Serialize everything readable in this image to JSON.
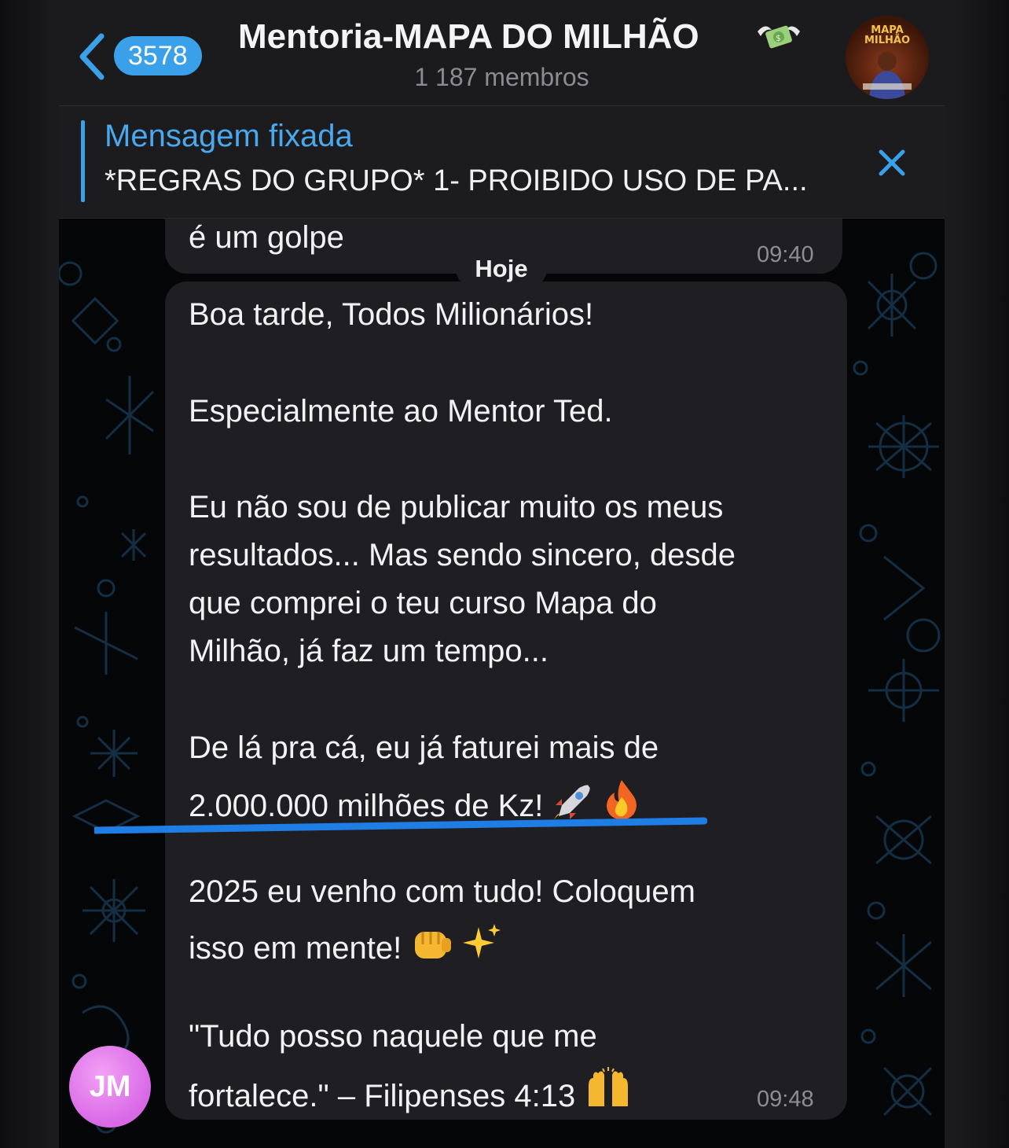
{
  "header": {
    "back_count": "3578",
    "title": "Mentoria-MAPA DO MILHÃO",
    "subtitle": "1 187 membros",
    "avatar_logo_line1": "MAPA",
    "avatar_logo_line2": "MILHÃO"
  },
  "pinned": {
    "label": "Mensagem fixada",
    "text": "*REGRAS DO GRUPO* 1- PROIBIDO USO DE PA..."
  },
  "chat": {
    "previous_message": {
      "text": "é um golpe",
      "time": "09:40"
    },
    "day_separator": "Hoje",
    "message": {
      "lines": [
        "Boa tarde, Todos Milionários!",
        "Especialmente ao Mentor Ted.",
        "Eu não sou de publicar muito os meus",
        "resultados... Mas sendo sincero, desde",
        "que comprei o teu curso Mapa do",
        "Milhão, já faz um tempo...",
        "De lá pra cá, eu já faturei mais de",
        "2.000.000 milhões de Kz!",
        "2025 eu venho com tudo! Coloquem",
        "isso em mente!",
        "\"Tudo posso naquele que me",
        "fortalece.\" – Filipenses 4:13"
      ],
      "time": "09:48",
      "sender_initials": "JM"
    }
  },
  "colors": {
    "accent": "#3aa0ea",
    "bubble": "#1f1f23",
    "avatar": "#e27eee"
  },
  "icons": [
    "chevron-left-icon",
    "money-with-wings-icon",
    "close-icon",
    "rocket-emoji",
    "fire-emoji",
    "fist-emoji",
    "sparkles-emoji",
    "raising-hands-emoji"
  ]
}
